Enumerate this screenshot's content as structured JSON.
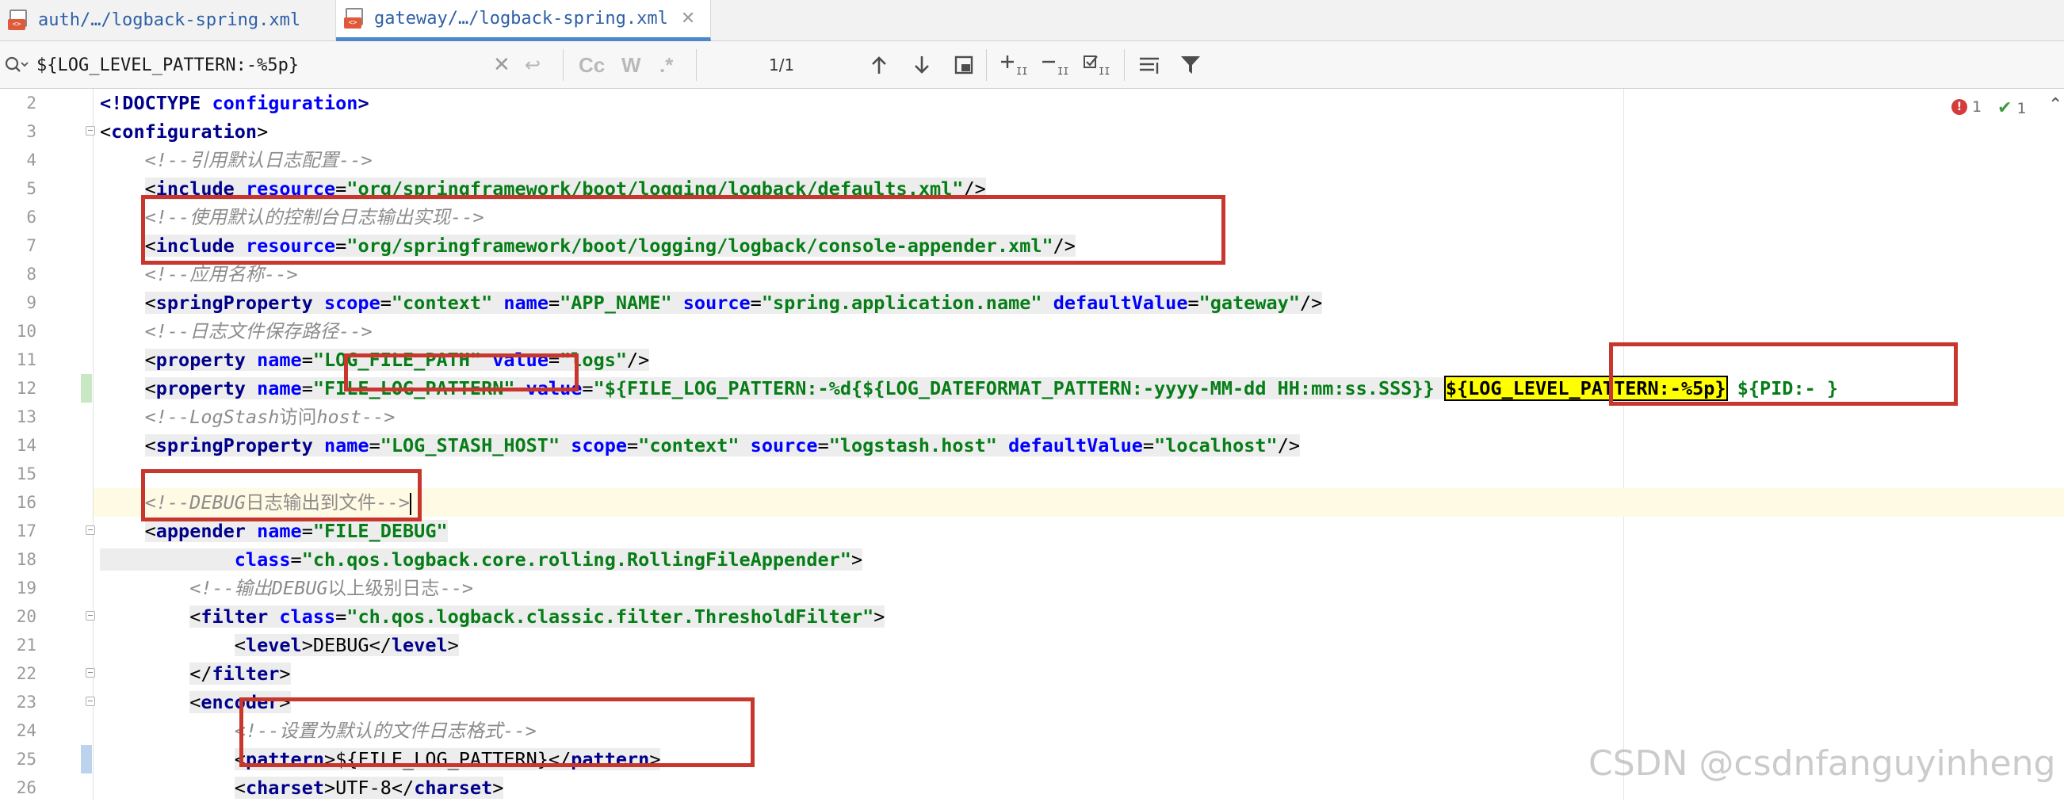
{
  "tabs": [
    {
      "label": "auth/…/logback-spring.xml",
      "icon": "xml-file-icon",
      "active": false
    },
    {
      "label": "gateway/…/logback-spring.xml",
      "icon": "xml-file-icon",
      "active": true
    }
  ],
  "search": {
    "value": "${LOG_LEVEL_PATTERN:-%5p}",
    "match_case_label": "Cc",
    "words_label": "W",
    "regex_label": ".*",
    "match_count": "1/1"
  },
  "inspections": {
    "errors": "1",
    "ok": "1"
  },
  "editor": {
    "lines": [
      {
        "n": "2"
      },
      {
        "n": "3"
      },
      {
        "n": "4"
      },
      {
        "n": "5"
      },
      {
        "n": "6"
      },
      {
        "n": "7"
      },
      {
        "n": "8"
      },
      {
        "n": "9"
      },
      {
        "n": "10"
      },
      {
        "n": "11"
      },
      {
        "n": "12"
      },
      {
        "n": "13"
      },
      {
        "n": "14"
      },
      {
        "n": "15"
      },
      {
        "n": "16"
      },
      {
        "n": "17"
      },
      {
        "n": "18"
      },
      {
        "n": "19"
      },
      {
        "n": "20"
      },
      {
        "n": "21"
      },
      {
        "n": "22"
      },
      {
        "n": "23"
      },
      {
        "n": "24"
      },
      {
        "n": "25"
      },
      {
        "n": "26"
      }
    ],
    "tokens": {
      "l2": [
        "<!DOCTYPE",
        "configuration",
        ">"
      ],
      "l3": [
        "<",
        "configuration",
        ">"
      ],
      "l4": "<!--引用默认日志配置-->",
      "l5": [
        "<",
        "include",
        " ",
        "resource",
        "=",
        "\"org/springframework/boot/logging/logback/defaults.xml\"",
        "/>"
      ],
      "l6": "<!--使用默认的控制台日志输出实现-->",
      "l7": [
        "<",
        "include",
        " ",
        "resource",
        "=",
        "\"org/springframework/boot/logging/logback/console-appender.xml\"",
        "/>"
      ],
      "l8": "<!--应用名称-->",
      "l9": [
        "<",
        "springProperty",
        " ",
        "scope",
        "=",
        "\"context\"",
        " ",
        "name",
        "=",
        "\"APP_NAME\"",
        " ",
        "source",
        "=",
        "\"spring.application.name\"",
        " ",
        "defaultValue",
        "=",
        "\"gateway\"",
        "/>"
      ],
      "l10": "<!--日志文件保存路径-->",
      "l11": [
        "<",
        "property",
        " ",
        "name",
        "=",
        "\"LOG_FILE_PATH\"",
        " ",
        "value",
        "=",
        "\"logs\"",
        "/>"
      ],
      "l12": [
        "<",
        "property",
        " ",
        "name",
        "=",
        "\"FILE_LOG_PATTERN\"",
        " ",
        "value",
        "=",
        "\"${FILE_LOG_PATTERN:-%d{${LOG_DATEFORMAT_PATTERN:-yyyy-MM-dd HH:mm:ss.SSS}} ",
        "${LOG_LEVEL_PATTERN:-%5p}",
        " ${PID:- }"
      ],
      "l13": [
        "<!--LogStash",
        "访问",
        "host-->"
      ],
      "l14": [
        "<",
        "springProperty",
        " ",
        "name",
        "=",
        "\"LOG_STASH_HOST\"",
        " ",
        "scope",
        "=",
        "\"context\"",
        " ",
        "source",
        "=",
        "\"logstash.host\"",
        " ",
        "defaultValue",
        "=",
        "\"localhost\"",
        "/>"
      ],
      "l16": [
        "<!--DEBUG",
        "日志输出到文件",
        "-->"
      ],
      "l17": [
        "<",
        "appender",
        " ",
        "name",
        "=",
        "\"FILE_DEBUG\""
      ],
      "l18": [
        "class",
        "=",
        "\"ch.qos.logback.core.rolling.RollingFileAppender\"",
        ">"
      ],
      "l19": [
        "<!--输出",
        "DEBUG",
        "以上级别日志-->"
      ],
      "l20": [
        "<",
        "filter",
        " ",
        "class",
        "=",
        "\"ch.qos.logback.classic.filter.ThresholdFilter\"",
        ">"
      ],
      "l21": [
        "<",
        "level",
        ">",
        "DEBUG",
        "</",
        "level",
        ">"
      ],
      "l22": [
        "</",
        "filter",
        ">"
      ],
      "l23": [
        "<",
        "encoder",
        ">"
      ],
      "l24": "<!--设置为默认的文件日志格式-->",
      "l25": [
        "<",
        "pattern",
        ">",
        "${FILE_LOG_PATTERN}",
        "</",
        "pattern",
        ">"
      ],
      "l26": [
        "<",
        "charset",
        ">",
        "UTF-8",
        "</",
        "charset",
        ">"
      ]
    }
  },
  "watermark": "CSDN @csdnfanguyinheng",
  "colors": {
    "tag": "#00008b",
    "attr": "#0000ff",
    "value": "#067d17",
    "comment": "#8c8c8c",
    "annotation_box": "#c8372d",
    "search_highlight": "#ffff00",
    "active_tab_underline": "#4a88c7"
  }
}
